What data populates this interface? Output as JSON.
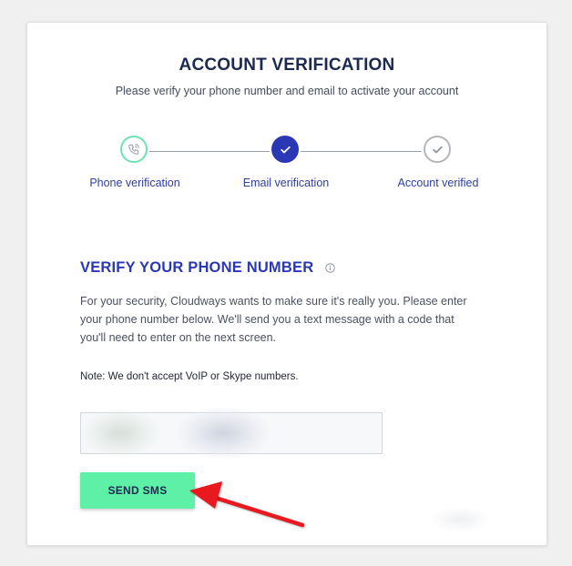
{
  "header": {
    "title": "ACCOUNT VERIFICATION",
    "subtitle": "Please verify your phone number and email to activate your account"
  },
  "steps": [
    {
      "label": "Phone verification",
      "state": "current",
      "icon": "phone-icon"
    },
    {
      "label": "Email verification",
      "state": "completed",
      "icon": "checkmark-icon"
    },
    {
      "label": "Account verified",
      "state": "pending",
      "icon": "checkmark-icon"
    }
  ],
  "section": {
    "title": "VERIFY YOUR PHONE NUMBER",
    "info_icon": "info-icon",
    "description": "For your security, Cloudways wants to make sure it's really you. Please enter your phone number below. We'll send you a text message with a code that you'll need to enter on the next screen.",
    "note": "Note: We don't accept VoIP or Skype numbers."
  },
  "form": {
    "phone_value": "",
    "send_label": "SEND SMS"
  },
  "colors": {
    "primary": "#2b38b5",
    "accent_green": "#5ff0a8",
    "step_current_border": "#6fe0b3",
    "step_pending_border": "#b2b5ba",
    "arrow": "#e8191f"
  }
}
